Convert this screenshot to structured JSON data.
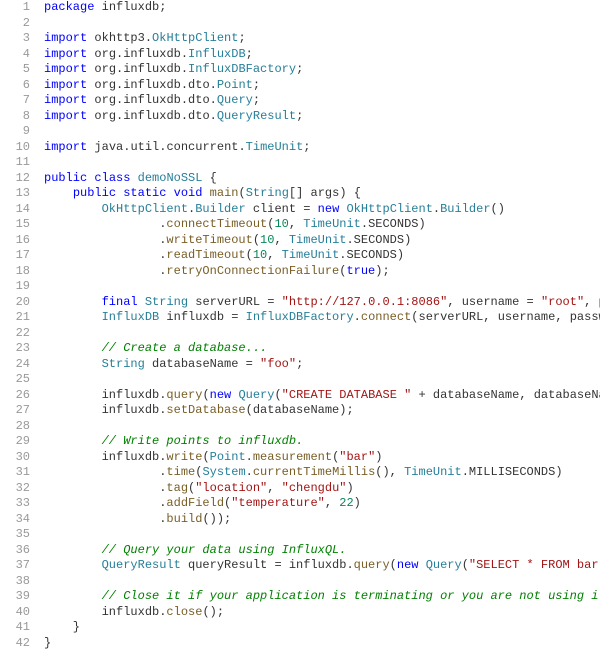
{
  "lines": [
    {
      "n": 1,
      "html": "<span class='kw'>package</span> <span class='pkg'>influxdb</span>;"
    },
    {
      "n": 2,
      "html": ""
    },
    {
      "n": 3,
      "html": "<span class='kw'>import</span> <span class='pkg'>okhttp3</span>.<span class='cls'>OkHttpClient</span>;"
    },
    {
      "n": 4,
      "html": "<span class='kw'>import</span> <span class='pkg'>org</span>.<span class='pkg'>influxdb</span>.<span class='cls'>InfluxDB</span>;"
    },
    {
      "n": 5,
      "html": "<span class='kw'>import</span> <span class='pkg'>org</span>.<span class='pkg'>influxdb</span>.<span class='cls'>InfluxDBFactory</span>;"
    },
    {
      "n": 6,
      "html": "<span class='kw'>import</span> <span class='pkg'>org</span>.<span class='pkg'>influxdb</span>.<span class='pkg'>dto</span>.<span class='cls'>Point</span>;"
    },
    {
      "n": 7,
      "html": "<span class='kw'>import</span> <span class='pkg'>org</span>.<span class='pkg'>influxdb</span>.<span class='pkg'>dto</span>.<span class='cls'>Query</span>;"
    },
    {
      "n": 8,
      "html": "<span class='kw'>import</span> <span class='pkg'>org</span>.<span class='pkg'>influxdb</span>.<span class='pkg'>dto</span>.<span class='cls'>QueryResult</span>;"
    },
    {
      "n": 9,
      "html": ""
    },
    {
      "n": 10,
      "html": "<span class='kw'>import</span> <span class='pkg'>java</span>.<span class='pkg'>util</span>.<span class='pkg'>concurrent</span>.<span class='cls'>TimeUnit</span>;"
    },
    {
      "n": 11,
      "html": ""
    },
    {
      "n": 12,
      "html": "<span class='kw'>public</span> <span class='kw'>class</span> <span class='cls'>demoNoSSL</span> {"
    },
    {
      "n": 13,
      "html": "    <span class='kw'>public</span> <span class='kw'>static</span> <span class='kw'>void</span> <span class='mtd'>main</span>(<span class='cls'>String</span>[] args) {"
    },
    {
      "n": 14,
      "html": "        <span class='cls'>OkHttpClient</span>.<span class='cls'>Builder</span> client = <span class='kw'>new</span> <span class='cls'>OkHttpClient</span>.<span class='cls'>Builder</span>()"
    },
    {
      "n": 15,
      "html": "                .<span class='mtd'>connectTimeout</span>(<span class='num'>10</span>, <span class='cls'>TimeUnit</span>.SECONDS)"
    },
    {
      "n": 16,
      "html": "                .<span class='mtd'>writeTimeout</span>(<span class='num'>10</span>, <span class='cls'>TimeUnit</span>.SECONDS)"
    },
    {
      "n": 17,
      "html": "                .<span class='mtd'>readTimeout</span>(<span class='num'>10</span>, <span class='cls'>TimeUnit</span>.SECONDS)"
    },
    {
      "n": 18,
      "html": "                .<span class='mtd'>retryOnConnectionFailure</span>(<span class='bool'>true</span>);"
    },
    {
      "n": 19,
      "html": ""
    },
    {
      "n": 20,
      "html": "        <span class='kw'>final</span> <span class='cls'>String</span> serverURL = <span class='str'>\"http://127.0.0.1:8086\"</span>, username = <span class='str'>\"root\"</span>, password = <span class='str'>\"root\"</span>;"
    },
    {
      "n": 21,
      "html": "        <span class='cls'>InfluxDB</span> influxdb = <span class='cls'>InfluxDBFactory</span>.<span class='mtd'>connect</span>(serverURL, username, password, client);"
    },
    {
      "n": 22,
      "html": ""
    },
    {
      "n": 23,
      "html": "        <span class='com'>// Create a database...</span>"
    },
    {
      "n": 24,
      "html": "        <span class='cls'>String</span> databaseName = <span class='str'>\"foo\"</span>;"
    },
    {
      "n": 25,
      "html": ""
    },
    {
      "n": 26,
      "html": "        influxdb.<span class='mtd'>query</span>(<span class='kw'>new</span> <span class='cls'>Query</span>(<span class='str'>\"CREATE DATABASE \"</span> + databaseName, databaseName));"
    },
    {
      "n": 27,
      "html": "        influxdb.<span class='mtd'>setDatabase</span>(databaseName);"
    },
    {
      "n": 28,
      "html": ""
    },
    {
      "n": 29,
      "html": "        <span class='com'>// Write points to influxdb.</span>"
    },
    {
      "n": 30,
      "html": "        influxdb.<span class='mtd'>write</span>(<span class='cls'>Point</span>.<span class='mtd'>measurement</span>(<span class='str'>\"bar\"</span>)"
    },
    {
      "n": 31,
      "html": "                .<span class='mtd'>time</span>(<span class='cls'>System</span>.<span class='mtd'>currentTimeMillis</span>(), <span class='cls'>TimeUnit</span>.MILLISECONDS)"
    },
    {
      "n": 32,
      "html": "                .<span class='mtd'>tag</span>(<span class='str'>\"location\"</span>, <span class='str'>\"chengdu\"</span>)"
    },
    {
      "n": 33,
      "html": "                .<span class='mtd'>addField</span>(<span class='str'>\"temperature\"</span>, <span class='num'>22</span>)"
    },
    {
      "n": 34,
      "html": "                .<span class='mtd'>build</span>());"
    },
    {
      "n": 35,
      "html": ""
    },
    {
      "n": 36,
      "html": "        <span class='com'>// Query your data using InfluxQL.</span>"
    },
    {
      "n": 37,
      "html": "        <span class='cls'>QueryResult</span> queryResult = influxdb.<span class='mtd'>query</span>(<span class='kw'>new</span> <span class='cls'>Query</span>(<span class='str'>\"SELECT * FROM bar\"</span>, databaseName));"
    },
    {
      "n": 38,
      "html": ""
    },
    {
      "n": 39,
      "html": "        <span class='com'>// Close it if your application is terminating or you are not using it anymore.</span>"
    },
    {
      "n": 40,
      "html": "        influxdb.<span class='mtd'>close</span>();"
    },
    {
      "n": 41,
      "html": "    }"
    },
    {
      "n": 42,
      "html": "}"
    }
  ]
}
